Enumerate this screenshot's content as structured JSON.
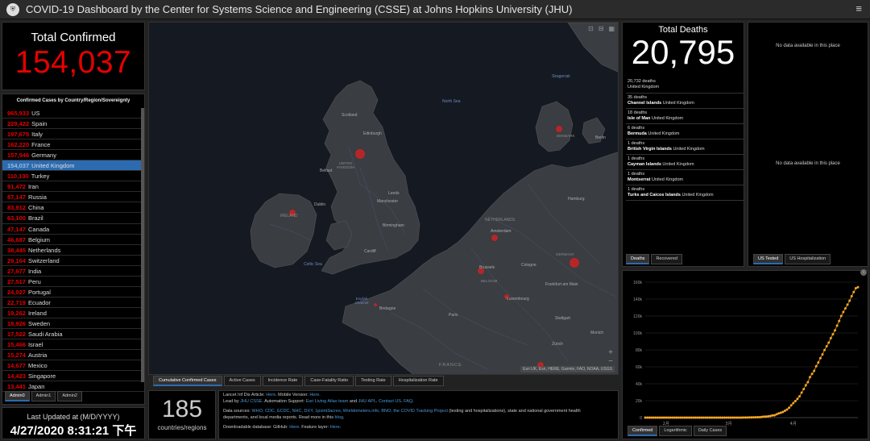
{
  "header": {
    "title": "COVID-19 Dashboard by the Center for Systems Science and Engineering (CSSE) at Johns Hopkins University (JHU)",
    "menu_glyph": "≡"
  },
  "total_confirmed": {
    "label": "Total Confirmed",
    "value": "154,037"
  },
  "cases_list": {
    "heading": "Confirmed Cases by Country/Region/Sovereignty",
    "rows": [
      {
        "count": "965,933",
        "name": "US"
      },
      {
        "count": "229,422",
        "name": "Spain"
      },
      {
        "count": "197,675",
        "name": "Italy"
      },
      {
        "count": "162,220",
        "name": "France"
      },
      {
        "count": "157,946",
        "name": "Germany"
      },
      {
        "count": "154,037",
        "name": "United Kingdom",
        "selected": true
      },
      {
        "count": "110,130",
        "name": "Turkey"
      },
      {
        "count": "91,472",
        "name": "Iran"
      },
      {
        "count": "87,147",
        "name": "Russia"
      },
      {
        "count": "83,912",
        "name": "China"
      },
      {
        "count": "63,100",
        "name": "Brazil"
      },
      {
        "count": "47,147",
        "name": "Canada"
      },
      {
        "count": "46,687",
        "name": "Belgium"
      },
      {
        "count": "38,445",
        "name": "Netherlands"
      },
      {
        "count": "29,164",
        "name": "Switzerland"
      },
      {
        "count": "27,977",
        "name": "India"
      },
      {
        "count": "27,517",
        "name": "Peru"
      },
      {
        "count": "24,027",
        "name": "Portugal"
      },
      {
        "count": "22,719",
        "name": "Ecuador"
      },
      {
        "count": "19,262",
        "name": "Ireland"
      },
      {
        "count": "18,926",
        "name": "Sweden"
      },
      {
        "count": "17,522",
        "name": "Saudi Arabia"
      },
      {
        "count": "15,466",
        "name": "Israel"
      },
      {
        "count": "15,274",
        "name": "Austria"
      },
      {
        "count": "14,677",
        "name": "Mexico"
      },
      {
        "count": "14,423",
        "name": "Singapore"
      },
      {
        "count": "13,441",
        "name": "Japan"
      }
    ],
    "tabs": [
      "Admin0",
      "Admin1",
      "Admin2"
    ]
  },
  "last_updated": {
    "label": "Last Updated at (M/D/YYYY)",
    "value": "4/27/2020 8:31:21 下午"
  },
  "map": {
    "labels": {
      "north_sea": "North Sea",
      "skagerrak": "Skagerrak",
      "scotland": "Scotland",
      "edinburgh": "Edinburgh",
      "united_kingdom": "UNITED KINGDOM",
      "belfast": "Belfast",
      "leeds": "Leeds",
      "manchester": "Manchester",
      "ireland": "IRELAND",
      "dublin": "Dublin",
      "birmingham": "Birmingham",
      "cardiff": "Cardiff",
      "celtic_sea": "Celtic Sea",
      "denmark": "DENMARK",
      "hamburg": "Hamburg",
      "netherlands": "NETHERLANDS",
      "amsterdam": "Amsterdam",
      "germany": "GERMANY",
      "brussels": "Brussels",
      "belgium": "BELGIUM",
      "cologne": "Cologne",
      "frankfurt": "Frankfurt am Main",
      "luxembourg": "Luxembourg",
      "english_channel": "English Channel",
      "brittany": "Bretagne",
      "paris": "Paris",
      "stuttgart": "Stuttgart",
      "munich": "Munich",
      "zurich": "Zürich",
      "france": "FRANCE",
      "berlin": "Berlin"
    },
    "attribution": "Esri UK, Esri, HERE, Garmin, FAO, NOAA, USGS",
    "zoom_in": "+",
    "zoom_out": "−",
    "tools": [
      "⊡",
      "⊟",
      "▦"
    ],
    "tabs": [
      "Cumulative Confirmed Cases",
      "Active Cases",
      "Incidence Rate",
      "Case-Fatality Ratio",
      "Testing Rate",
      "Hospitalization Rate"
    ]
  },
  "countries_count": {
    "value": "185",
    "label": "countries/regions"
  },
  "sources": {
    "line1_prefix": "Lancet Inf Dis Article: ",
    "line1_link1": "Here",
    "line1_mid": ". Mobile Version: ",
    "line1_link2": "Here",
    "line1_end": ".",
    "line2_prefix": "Lead by ",
    "line2_link1": "JHU CSSE",
    "line2_mid": ". Automation Support: ",
    "line2_link2": "Esri Living Atlas team",
    "line2_and": " and ",
    "line2_link3": "JHU APL",
    "line2_sep": ". ",
    "line2_link4": "Contact US",
    "line2_comma": ". ",
    "line2_link5": "FAQ",
    "line2_end": ".",
    "line3_prefix": "Data sources: ",
    "line3_links": "WHO, CDC, ECDC, NHC, DXY, 1point3acres, Worldometers.info, BNO, the COVID Tracking Project",
    "line3_end": " (testing and hospitalizations), state and national government health",
    "line4": "departments, and local media reports.  Read more in this ",
    "line4_link": "blog",
    "line4_end": ".",
    "line5_prefix": "Downloadable database: GitHub: ",
    "line5_link1": "Here",
    "line5_mid": ". Feature layer: ",
    "line5_link2": "Here",
    "line5_end": "."
  },
  "deaths": {
    "label": "Total Deaths",
    "value": "20,795",
    "items": [
      {
        "count": "20,732 deaths",
        "place": "",
        "country": "United Kingdom"
      },
      {
        "count": "35 deaths",
        "place": "Channel Islands",
        "country": "United Kingdom"
      },
      {
        "count": "18 deaths",
        "place": "Isle of Man",
        "country": "United Kingdom"
      },
      {
        "count": "6 deaths",
        "place": "Bermuda",
        "country": "United Kingdom"
      },
      {
        "count": "1 deaths",
        "place": "British Virgin Islands",
        "country": "United Kingdom"
      },
      {
        "count": "1 deaths",
        "place": "Cayman Islands",
        "country": "United Kingdom"
      },
      {
        "count": "1 deaths",
        "place": "Montserrat",
        "country": "United Kingdom"
      },
      {
        "count": "1 deaths",
        "place": "Turks and Caicos Islands",
        "country": "United Kingdom"
      }
    ],
    "tabs": [
      "Deaths",
      "Recovered"
    ]
  },
  "testing": {
    "nodata_top": "No data available in this place",
    "nodata_mid": "No data available in this place",
    "tabs": [
      "US Tested",
      "US Hospitalization"
    ]
  },
  "chart_data": {
    "type": "scatter",
    "title": "",
    "xlabel": "",
    "ylabel": "",
    "y_ticks": [
      "0",
      "20k",
      "40k",
      "60k",
      "80k",
      "100k",
      "120k",
      "140k",
      "160k"
    ],
    "ylim": [
      0,
      160000
    ],
    "x_ticks": [
      "2月",
      "3月",
      "4月"
    ],
    "series": [
      {
        "color": "#f5a623",
        "values": [
          0,
          0,
          0,
          0,
          0,
          0,
          0,
          0,
          0,
          2,
          2,
          2,
          2,
          2,
          2,
          2,
          2,
          8,
          8,
          9,
          9,
          9,
          9,
          9,
          9,
          9,
          9,
          9,
          9,
          9,
          9,
          9,
          9,
          9,
          9,
          9,
          9,
          9,
          13,
          13,
          13,
          15,
          20,
          23,
          36,
          40,
          51,
          85,
          115,
          163,
          206,
          273,
          321,
          382,
          456,
          456,
          798,
          1140,
          1140,
          1543,
          1950,
          2626,
          2689,
          3983,
          5018,
          5683,
          6650,
          8077,
          9529,
          11658,
          14543,
          17089,
          19522,
          22141,
          25150,
          29474,
          33718,
          38168,
          41903,
          47806,
          51608,
          55242,
          60733,
          65077,
          70272,
          74605,
          79874,
          84279,
          88621,
          93873,
          98476,
          103093,
          108692,
          114217,
          120067,
          124743,
          129044,
          133495,
          138078,
          143464,
          148377,
          152840,
          154037
        ]
      }
    ],
    "tabs": [
      "Confirmed",
      "Logarithmic",
      "Daily Cases"
    ],
    "marker_color": "#f5a623"
  }
}
